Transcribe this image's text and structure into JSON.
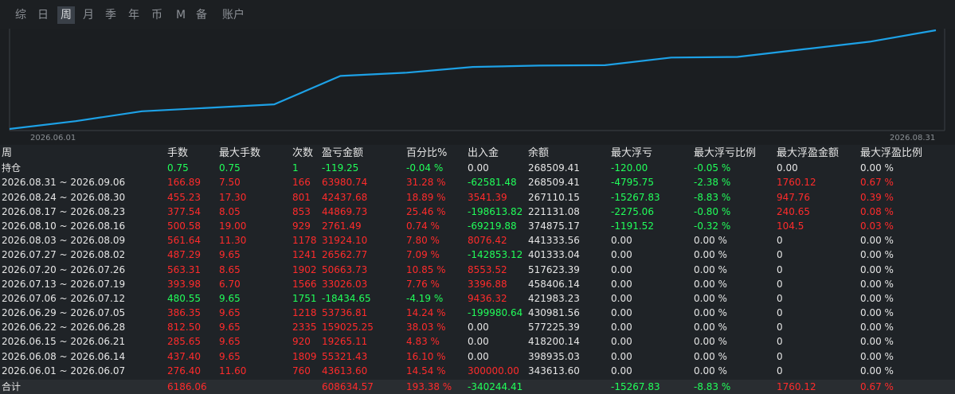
{
  "tabs": [
    {
      "label": "综",
      "active": false
    },
    {
      "label": "日",
      "active": false
    },
    {
      "label": "周",
      "active": true
    },
    {
      "label": "月",
      "active": false
    },
    {
      "label": "季",
      "active": false
    },
    {
      "label": "年",
      "active": false
    },
    {
      "label": "币",
      "active": false
    },
    {
      "label": "M",
      "active": false
    },
    {
      "label": "备",
      "active": false
    },
    {
      "label": "账户",
      "active": false
    }
  ],
  "chart_data": {
    "type": "line",
    "x_start_label": "2026.06.01",
    "x_end_label": "2026.08.31",
    "color": "#1da1e6",
    "series": [
      {
        "values": [
          0,
          43614,
          98935,
          118200,
          137465,
          296490,
          314945,
          346839,
          354402,
          356690,
          399633,
          403001,
          445870,
          488307,
          552288
        ]
      }
    ]
  },
  "table": {
    "headers": [
      "周",
      "手数",
      "最大手数",
      "次数",
      "盈亏金额",
      "百分比%",
      "出入金",
      "余额",
      "最大浮亏",
      "最大浮亏比例",
      "最大浮盈金额",
      "最大浮盈比例"
    ],
    "holding": {
      "period": "持仓",
      "lots": "0.75",
      "max_lots": "0.75",
      "count": "1",
      "pnl": "-119.25",
      "pct": "-0.04 %",
      "flow": "0.00",
      "balance": "268509.41",
      "max_loss": "-120.00",
      "max_loss_pct": "-0.05 %",
      "max_profit": "0.00",
      "max_profit_pct": "0.00 %",
      "colors": [
        "white",
        "green",
        "green",
        "green",
        "green",
        "green",
        "white",
        "white",
        "green",
        "green",
        "white",
        "white"
      ]
    },
    "rows": [
      {
        "period": "2026.08.31 ~ 2026.09.06",
        "lots": "166.89",
        "max_lots": "7.50",
        "count": "166",
        "pnl": "63980.74",
        "pct": "31.28 %",
        "flow": "-62581.48",
        "balance": "268509.41",
        "max_loss": "-4795.75",
        "max_loss_pct": "-2.38 %",
        "max_profit": "1760.12",
        "max_profit_pct": "0.67 %",
        "colors": [
          "white",
          "red",
          "red",
          "red",
          "red",
          "red",
          "green",
          "white",
          "green",
          "green",
          "red",
          "red"
        ]
      },
      {
        "period": "2026.08.24 ~ 2026.08.30",
        "lots": "455.23",
        "max_lots": "17.30",
        "count": "801",
        "pnl": "42437.68",
        "pct": "18.89 %",
        "flow": "3541.39",
        "balance": "267110.15",
        "max_loss": "-15267.83",
        "max_loss_pct": "-8.83 %",
        "max_profit": "947.76",
        "max_profit_pct": "0.39 %",
        "colors": [
          "white",
          "red",
          "red",
          "red",
          "red",
          "red",
          "red",
          "white",
          "green",
          "green",
          "red",
          "red"
        ]
      },
      {
        "period": "2026.08.17 ~ 2026.08.23",
        "lots": "377.54",
        "max_lots": "8.05",
        "count": "853",
        "pnl": "44869.73",
        "pct": "25.46 %",
        "flow": "-198613.82",
        "balance": "221131.08",
        "max_loss": "-2275.06",
        "max_loss_pct": "-0.80 %",
        "max_profit": "240.65",
        "max_profit_pct": "0.08 %",
        "colors": [
          "white",
          "red",
          "red",
          "red",
          "red",
          "red",
          "green",
          "white",
          "green",
          "green",
          "red",
          "red"
        ]
      },
      {
        "period": "2026.08.10 ~ 2026.08.16",
        "lots": "500.58",
        "max_lots": "19.00",
        "count": "929",
        "pnl": "2761.49",
        "pct": "0.74 %",
        "flow": "-69219.88",
        "balance": "374875.17",
        "max_loss": "-1191.52",
        "max_loss_pct": "-0.32 %",
        "max_profit": "104.5",
        "max_profit_pct": "0.03 %",
        "colors": [
          "white",
          "red",
          "red",
          "red",
          "red",
          "red",
          "green",
          "white",
          "green",
          "green",
          "red",
          "red"
        ]
      },
      {
        "period": "2026.08.03 ~ 2026.08.09",
        "lots": "561.64",
        "max_lots": "11.30",
        "count": "1178",
        "pnl": "31924.10",
        "pct": "7.80 %",
        "flow": "8076.42",
        "balance": "441333.56",
        "max_loss": "0.00",
        "max_loss_pct": "0.00 %",
        "max_profit": "0",
        "max_profit_pct": "0.00 %",
        "colors": [
          "white",
          "red",
          "red",
          "red",
          "red",
          "red",
          "red",
          "white",
          "white",
          "white",
          "white",
          "white"
        ]
      },
      {
        "period": "2026.07.27 ~ 2026.08.02",
        "lots": "487.29",
        "max_lots": "9.65",
        "count": "1241",
        "pnl": "26562.77",
        "pct": "7.09 %",
        "flow": "-142853.12",
        "balance": "401333.04",
        "max_loss": "0.00",
        "max_loss_pct": "0.00 %",
        "max_profit": "0",
        "max_profit_pct": "0.00 %",
        "colors": [
          "white",
          "red",
          "red",
          "red",
          "red",
          "red",
          "green",
          "white",
          "white",
          "white",
          "white",
          "white"
        ]
      },
      {
        "period": "2026.07.20 ~ 2026.07.26",
        "lots": "563.31",
        "max_lots": "8.65",
        "count": "1902",
        "pnl": "50663.73",
        "pct": "10.85 %",
        "flow": "8553.52",
        "balance": "517623.39",
        "max_loss": "0.00",
        "max_loss_pct": "0.00 %",
        "max_profit": "0",
        "max_profit_pct": "0.00 %",
        "colors": [
          "white",
          "red",
          "red",
          "red",
          "red",
          "red",
          "red",
          "white",
          "white",
          "white",
          "white",
          "white"
        ]
      },
      {
        "period": "2026.07.13 ~ 2026.07.19",
        "lots": "393.98",
        "max_lots": "6.70",
        "count": "1566",
        "pnl": "33026.03",
        "pct": "7.76 %",
        "flow": "3396.88",
        "balance": "458406.14",
        "max_loss": "0.00",
        "max_loss_pct": "0.00 %",
        "max_profit": "0",
        "max_profit_pct": "0.00 %",
        "colors": [
          "white",
          "red",
          "red",
          "red",
          "red",
          "red",
          "red",
          "white",
          "white",
          "white",
          "white",
          "white"
        ]
      },
      {
        "period": "2026.07.06 ~ 2026.07.12",
        "lots": "480.55",
        "max_lots": "9.65",
        "count": "1751",
        "pnl": "-18434.65",
        "pct": "-4.19 %",
        "flow": "9436.32",
        "balance": "421983.23",
        "max_loss": "0.00",
        "max_loss_pct": "0.00 %",
        "max_profit": "0",
        "max_profit_pct": "0.00 %",
        "colors": [
          "white",
          "green",
          "green",
          "green",
          "green",
          "green",
          "red",
          "white",
          "white",
          "white",
          "white",
          "white"
        ]
      },
      {
        "period": "2026.06.29 ~ 2026.07.05",
        "lots": "386.35",
        "max_lots": "9.65",
        "count": "1218",
        "pnl": "53736.81",
        "pct": "14.24 %",
        "flow": "-199980.64",
        "balance": "430981.56",
        "max_loss": "0.00",
        "max_loss_pct": "0.00 %",
        "max_profit": "0",
        "max_profit_pct": "0.00 %",
        "colors": [
          "white",
          "red",
          "red",
          "red",
          "red",
          "red",
          "green",
          "white",
          "white",
          "white",
          "white",
          "white"
        ]
      },
      {
        "period": "2026.06.22 ~ 2026.06.28",
        "lots": "812.50",
        "max_lots": "9.65",
        "count": "2335",
        "pnl": "159025.25",
        "pct": "38.03 %",
        "flow": "0.00",
        "balance": "577225.39",
        "max_loss": "0.00",
        "max_loss_pct": "0.00 %",
        "max_profit": "0",
        "max_profit_pct": "0.00 %",
        "colors": [
          "white",
          "red",
          "red",
          "red",
          "red",
          "red",
          "white",
          "white",
          "white",
          "white",
          "white",
          "white"
        ]
      },
      {
        "period": "2026.06.15 ~ 2026.06.21",
        "lots": "285.65",
        "max_lots": "9.65",
        "count": "920",
        "pnl": "19265.11",
        "pct": "4.83 %",
        "flow": "0.00",
        "balance": "418200.14",
        "max_loss": "0.00",
        "max_loss_pct": "0.00 %",
        "max_profit": "0",
        "max_profit_pct": "0.00 %",
        "colors": [
          "white",
          "red",
          "red",
          "red",
          "red",
          "red",
          "white",
          "white",
          "white",
          "white",
          "white",
          "white"
        ]
      },
      {
        "period": "2026.06.08 ~ 2026.06.14",
        "lots": "437.40",
        "max_lots": "9.65",
        "count": "1809",
        "pnl": "55321.43",
        "pct": "16.10 %",
        "flow": "0.00",
        "balance": "398935.03",
        "max_loss": "0.00",
        "max_loss_pct": "0.00 %",
        "max_profit": "0",
        "max_profit_pct": "0.00 %",
        "colors": [
          "white",
          "red",
          "red",
          "red",
          "red",
          "red",
          "white",
          "white",
          "white",
          "white",
          "white",
          "white"
        ]
      },
      {
        "period": "2026.06.01 ~ 2026.06.07",
        "lots": "276.40",
        "max_lots": "11.60",
        "count": "760",
        "pnl": "43613.60",
        "pct": "14.54 %",
        "flow": "300000.00",
        "balance": "343613.60",
        "max_loss": "0.00",
        "max_loss_pct": "0.00 %",
        "max_profit": "0",
        "max_profit_pct": "0.00 %",
        "colors": [
          "white",
          "red",
          "red",
          "red",
          "red",
          "red",
          "red",
          "white",
          "white",
          "white",
          "white",
          "white"
        ]
      }
    ],
    "total": {
      "period": "合计",
      "lots": "6186.06",
      "max_lots": "",
      "count": "",
      "pnl": "608634.57",
      "pct": "193.38 %",
      "flow": "-340244.41",
      "balance": "",
      "max_loss": "-15267.83",
      "max_loss_pct": "-8.83 %",
      "max_profit": "1760.12",
      "max_profit_pct": "0.67 %",
      "colors": [
        "white",
        "red",
        "red",
        "red",
        "red",
        "red",
        "green",
        "white",
        "green",
        "green",
        "red",
        "red"
      ]
    }
  }
}
